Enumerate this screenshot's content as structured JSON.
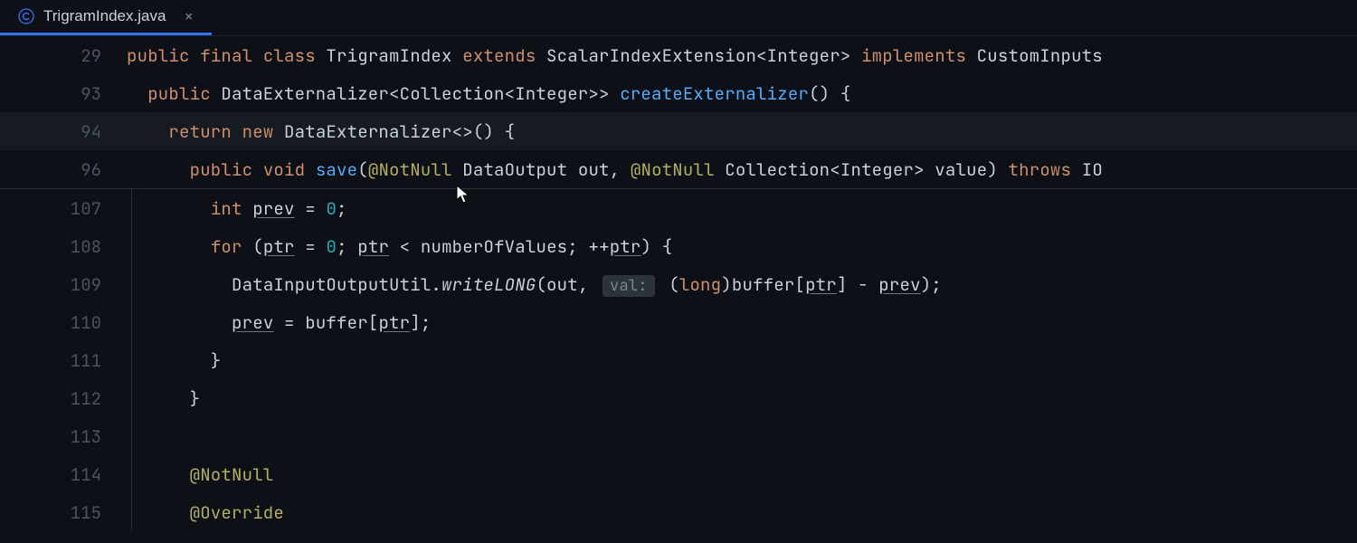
{
  "tab": {
    "label": "TrigramIndex.java",
    "icon_name": "java-class-icon"
  },
  "sticky": [
    {
      "num": "29",
      "tokens": [
        {
          "t": "public ",
          "c": "kw"
        },
        {
          "t": "final ",
          "c": "kw"
        },
        {
          "t": "class ",
          "c": "kw"
        },
        {
          "t": "TrigramIndex ",
          "c": "type"
        },
        {
          "t": "extends ",
          "c": "kw"
        },
        {
          "t": "ScalarIndexExtension<Integer> ",
          "c": "type"
        },
        {
          "t": "implements ",
          "c": "kw"
        },
        {
          "t": "CustomInputs",
          "c": "type"
        }
      ]
    },
    {
      "num": "93",
      "tokens": [
        {
          "t": "  ",
          "c": ""
        },
        {
          "t": "public ",
          "c": "kw"
        },
        {
          "t": "DataExternalizer<Collection<Integer>> ",
          "c": "type"
        },
        {
          "t": "createExternalizer",
          "c": "method-decl"
        },
        {
          "t": "() {",
          "c": "punct"
        }
      ]
    },
    {
      "num": "94",
      "highlighted": true,
      "tokens": [
        {
          "t": "    ",
          "c": ""
        },
        {
          "t": "return ",
          "c": "kw"
        },
        {
          "t": "new ",
          "c": "kw"
        },
        {
          "t": "DataExternalizer<>() {",
          "c": "type"
        }
      ]
    },
    {
      "num": "96",
      "tokens": [
        {
          "t": "      ",
          "c": ""
        },
        {
          "t": "public ",
          "c": "kw"
        },
        {
          "t": "void ",
          "c": "kw"
        },
        {
          "t": "save",
          "c": "method-decl"
        },
        {
          "t": "(",
          "c": "punct"
        },
        {
          "t": "@NotNull ",
          "c": "anno"
        },
        {
          "t": "DataOutput ",
          "c": "type"
        },
        {
          "t": "out",
          "c": "param"
        },
        {
          "t": ", ",
          "c": "punct"
        },
        {
          "t": "@NotNull ",
          "c": "anno"
        },
        {
          "t": "Collection<Integer> ",
          "c": "type"
        },
        {
          "t": "value",
          "c": "param"
        },
        {
          "t": ") ",
          "c": "punct"
        },
        {
          "t": "throws ",
          "c": "kw"
        },
        {
          "t": "IO",
          "c": "type"
        }
      ]
    }
  ],
  "lines": [
    {
      "num": "107",
      "tokens": [
        {
          "t": "        ",
          "c": ""
        },
        {
          "t": "int ",
          "c": "kw"
        },
        {
          "t": "prev",
          "c": "local"
        },
        {
          "t": " = ",
          "c": "punct"
        },
        {
          "t": "0",
          "c": "num"
        },
        {
          "t": ";",
          "c": "punct"
        }
      ]
    },
    {
      "num": "108",
      "tokens": [
        {
          "t": "        ",
          "c": ""
        },
        {
          "t": "for ",
          "c": "kw"
        },
        {
          "t": "(",
          "c": "punct"
        },
        {
          "t": "ptr",
          "c": "local"
        },
        {
          "t": " = ",
          "c": "punct"
        },
        {
          "t": "0",
          "c": "num"
        },
        {
          "t": "; ",
          "c": "punct"
        },
        {
          "t": "ptr",
          "c": "local"
        },
        {
          "t": " < numberOfValues; ++",
          "c": "punct"
        },
        {
          "t": "ptr",
          "c": "local"
        },
        {
          "t": ") {",
          "c": "punct"
        }
      ]
    },
    {
      "num": "109",
      "tokens": [
        {
          "t": "          ",
          "c": ""
        },
        {
          "t": "DataInputOutputUtil.",
          "c": "type"
        },
        {
          "t": "writeLONG",
          "c": "method-italic"
        },
        {
          "t": "(out, ",
          "c": "punct"
        },
        {
          "t": "val:",
          "c": "inlay",
          "inlay": true
        },
        {
          "t": " (",
          "c": "punct"
        },
        {
          "t": "long",
          "c": "kw"
        },
        {
          "t": ")buffer[",
          "c": "punct"
        },
        {
          "t": "ptr",
          "c": "local"
        },
        {
          "t": "] - ",
          "c": "punct"
        },
        {
          "t": "prev",
          "c": "local"
        },
        {
          "t": ");",
          "c": "punct"
        }
      ]
    },
    {
      "num": "110",
      "tokens": [
        {
          "t": "          ",
          "c": ""
        },
        {
          "t": "prev",
          "c": "local"
        },
        {
          "t": " = buffer[",
          "c": "punct"
        },
        {
          "t": "ptr",
          "c": "local"
        },
        {
          "t": "];",
          "c": "punct"
        }
      ]
    },
    {
      "num": "111",
      "tokens": [
        {
          "t": "        }",
          "c": "punct"
        }
      ]
    },
    {
      "num": "112",
      "tokens": [
        {
          "t": "      }",
          "c": "punct"
        }
      ]
    },
    {
      "num": "113",
      "tokens": []
    },
    {
      "num": "114",
      "tokens": [
        {
          "t": "      ",
          "c": ""
        },
        {
          "t": "@NotNull",
          "c": "anno"
        }
      ]
    },
    {
      "num": "115",
      "tokens": [
        {
          "t": "      ",
          "c": ""
        },
        {
          "t": "@Override",
          "c": "anno"
        }
      ]
    }
  ]
}
